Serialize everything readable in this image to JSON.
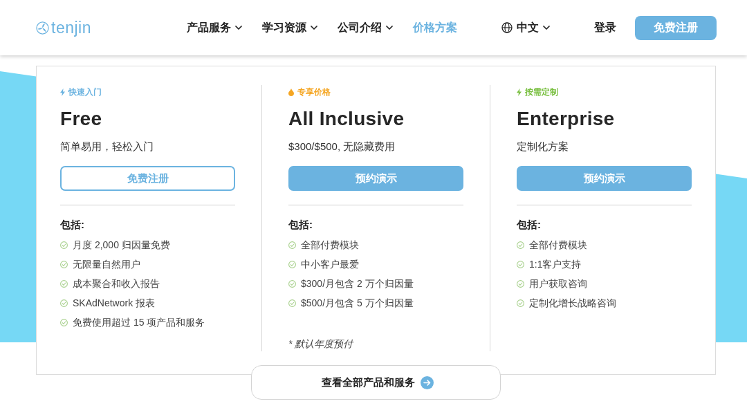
{
  "header": {
    "logo": "tenjin",
    "nav": [
      {
        "label": "产品服务",
        "dropdown": true,
        "selected": false
      },
      {
        "label": "学习资源",
        "dropdown": true,
        "selected": false
      },
      {
        "label": "公司介绍",
        "dropdown": true,
        "selected": false
      },
      {
        "label": "价格方案",
        "dropdown": false,
        "selected": true
      }
    ],
    "language": "中文",
    "login": "登录",
    "signup": "免费注册"
  },
  "plans": [
    {
      "tag": {
        "label": "快速入门",
        "kind": "bolt",
        "color": "#6bb3e0"
      },
      "name": "Free",
      "subtitle": "简单易用，轻松入门",
      "button": {
        "label": "免费注册",
        "kind": "outline"
      },
      "includes_label": "包括:",
      "features": [
        "月度 2,000 归因量免费",
        "无限量自然用户",
        "成本聚合和收入报告",
        "SKAdNetwork 报表",
        "免费使用超过 15 项产品和服务"
      ]
    },
    {
      "tag": {
        "label": "专享价格",
        "kind": "flame",
        "color": "#f5a623"
      },
      "name": "All Inclusive",
      "subtitle": "$300/$500, 无隐藏费用",
      "button": {
        "label": "预约演示",
        "kind": "filled"
      },
      "includes_label": "包括:",
      "features": [
        "全部付费模块",
        "中小客户最爱",
        "$300/月包含 2 万个归因量",
        "$500/月包含 5 万个归因量"
      ],
      "note": "* 默认年度预付"
    },
    {
      "tag": {
        "label": "按需定制",
        "kind": "bolt",
        "color": "#7bc043"
      },
      "name": "Enterprise",
      "subtitle": "定制化方案",
      "button": {
        "label": "预约演示",
        "kind": "filled"
      },
      "includes_label": "包括:",
      "features": [
        "全部付费模块",
        "1:1客户支持",
        "用户获取咨询",
        "定制化增长战略咨询"
      ]
    }
  ],
  "all_products_button": "查看全部产品和服务"
}
